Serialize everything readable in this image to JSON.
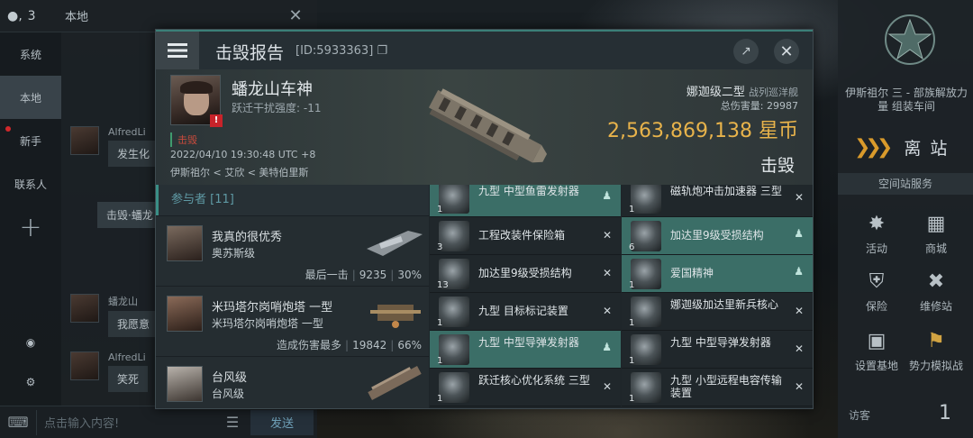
{
  "chat": {
    "member_count": "3",
    "channel_title": "本地",
    "sidebar": [
      "系统",
      "本地",
      "新手",
      "联系人"
    ],
    "messages": [
      {
        "name": "AlfredLi",
        "text": "发生化"
      },
      {
        "name": "蟠龙山",
        "text": "我愿意"
      },
      {
        "name": "AlfredLi",
        "text": "笑死"
      }
    ],
    "kill_link": "击毁·蟠龙",
    "input_placeholder": "点击输入内容!",
    "send_label": "发送"
  },
  "station": {
    "name": "伊斯祖尔 三 - 部族解放力量 组装车间",
    "undock_label": "离 站",
    "services_title": "空间站服务",
    "services": [
      "活动",
      "商城",
      "保险",
      "维修站",
      "设置基地",
      "势力模拟战"
    ],
    "visitor_label": "访客",
    "visitor_count": "1"
  },
  "report": {
    "title": "击毁报告",
    "id": "[ID:5933363]",
    "victim": {
      "name": "蟠龙山车神",
      "warp": "跃迁干扰强度: -11",
      "status": "击毁",
      "time": "2022/04/10 19:30:48 UTC +8",
      "location": "伊斯祖尔 < 艾欣 < 美特伯里斯"
    },
    "ship_type": "娜迦级二型",
    "ship_class": "战列巡洋舰",
    "total_damage": "总伤害量: 29987",
    "isk": "2,563,869,138  星币",
    "result": "击毁",
    "participants_header": "参与者 [11]",
    "participants": [
      {
        "name": "我真的很优秀",
        "ship": "奥苏斯级",
        "stat_label": "最后一击",
        "damage": "9235",
        "percent": "30%"
      },
      {
        "name": "米玛塔尔岗哨炮塔 一型",
        "ship": "米玛塔尔岗哨炮塔 一型",
        "stat_label": "造成伤害最多",
        "damage": "19842",
        "percent": "66%"
      },
      {
        "name": "台风级",
        "ship": "台风级",
        "stat_label": "",
        "damage": "",
        "percent": ""
      }
    ],
    "items_left": [
      {
        "qty": "1",
        "name": "九型 中型鱼雷发射器",
        "mark": "pilot"
      },
      {
        "qty": "3",
        "name": "工程改装件保险箱",
        "mark": "x"
      },
      {
        "qty": "13",
        "name": "加达里9级受损结构",
        "mark": "x"
      },
      {
        "qty": "1",
        "name": "九型 目标标记装置",
        "mark": "x"
      },
      {
        "qty": "1",
        "name": "九型 中型导弹发射器",
        "mark": "pilot"
      },
      {
        "qty": "1",
        "name": "跃迁核心优化系统 三型",
        "mark": "x"
      }
    ],
    "items_right": [
      {
        "qty": "1",
        "name": "磁轨炮冲击加速器 三型",
        "mark": "x"
      },
      {
        "qty": "6",
        "name": "加达里9级受损结构",
        "mark": "pilot"
      },
      {
        "qty": "1",
        "name": "爱国精神",
        "mark": "pilot"
      },
      {
        "qty": "1",
        "name": "娜迦级加达里新兵核心",
        "mark": "x"
      },
      {
        "qty": "1",
        "name": "九型 中型导弹发射器",
        "mark": "x"
      },
      {
        "qty": "1",
        "name": "九型 小型远程电容传输装置",
        "mark": "x"
      }
    ],
    "item_highlight_left": [
      true,
      false,
      false,
      false,
      true,
      false
    ],
    "item_highlight_right": [
      false,
      true,
      true,
      false,
      false,
      false
    ]
  }
}
